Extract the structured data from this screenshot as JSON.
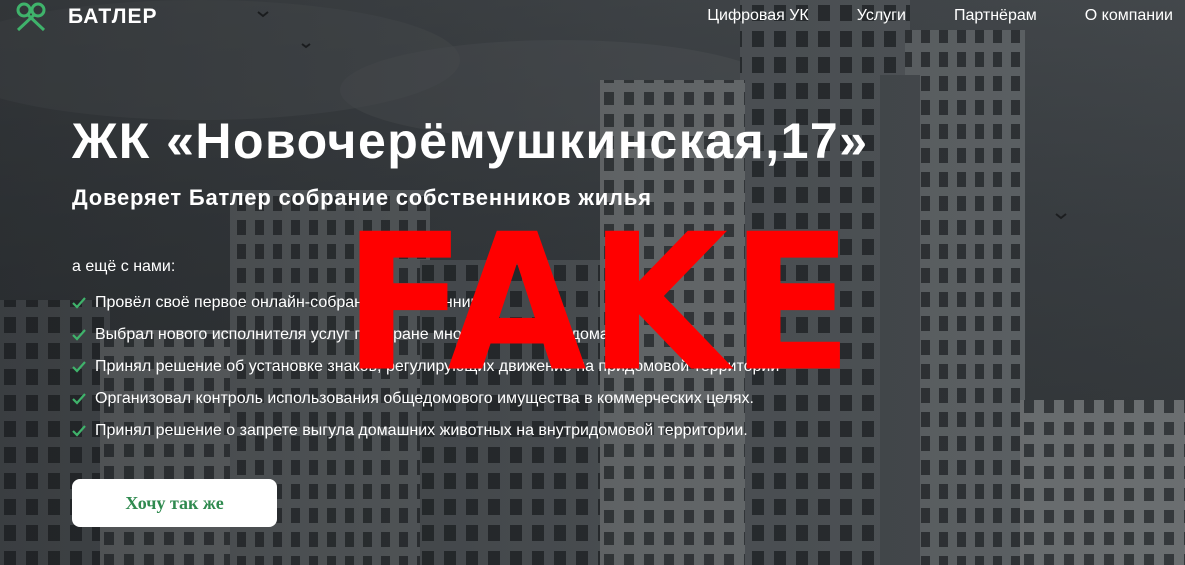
{
  "brand": {
    "name": "БАТЛЕР",
    "icon": "butler-keys-logo-icon",
    "accent": "#2f8a4f"
  },
  "nav": {
    "items": [
      {
        "label": "Цифровая УК"
      },
      {
        "label": "Услуги"
      },
      {
        "label": "Партнёрам"
      },
      {
        "label": "О компании"
      }
    ]
  },
  "hero": {
    "title": "ЖК «Новочерёмушкинская,17»",
    "subtitle": "Доверяет Батлер собрание собственников жилья",
    "intro": "а ещё с нами:",
    "features": [
      "Провёл своё первое онлайн-собрание собственников",
      "Выбрал нового исполнителя услуг по охране многоквартирного дома",
      "Принял решение об установке знаков, регулирующих движение на придомовой территории",
      "Организовал контроль использования общедомового имущества в коммерческих целях.",
      "Принял решение о запрете выгула домашних животных на внутридомовой территории."
    ],
    "check_icon": "checkmark-icon",
    "check_color": "#3fb36b",
    "cta_label": "Хочу так же"
  },
  "overlay": {
    "text": "FAKE",
    "color": "#ff0000"
  }
}
